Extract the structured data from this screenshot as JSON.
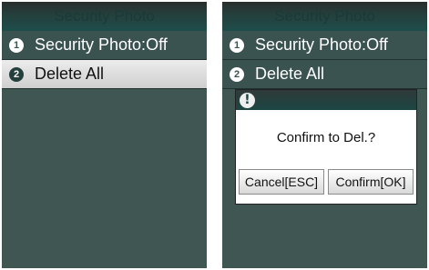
{
  "left_screen": {
    "title": "Security Photo",
    "menu": [
      {
        "number": "1",
        "label": "Security Photo:Off",
        "selected": false
      },
      {
        "number": "2",
        "label": "Delete All",
        "selected": true
      }
    ]
  },
  "right_screen": {
    "title": "Security Photo",
    "menu": [
      {
        "number": "1",
        "label": "Security Photo:Off"
      },
      {
        "number": "2",
        "label": "Delete All"
      }
    ],
    "dialog": {
      "icon": "!",
      "message": "Confirm to Del.?",
      "cancel_label": "Cancel[ESC]",
      "confirm_label": "Confirm[OK]"
    }
  },
  "colors": {
    "screen_bg": "#3f5652",
    "title_bar": "#1e4d4a",
    "selected_row": "#e0e0e0"
  }
}
